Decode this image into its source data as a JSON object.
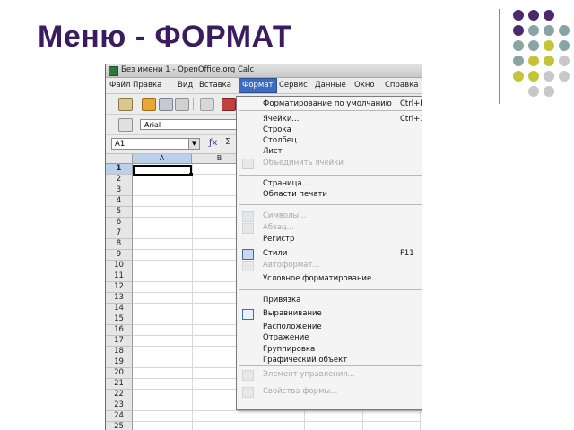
{
  "slide": {
    "title": "Меню - ФОРМАТ",
    "decor_colors": {
      "purple": "#4a2a6a",
      "teal": "#8aa4a4",
      "olive": "#c4c43a",
      "gray": "#c8c8c8"
    }
  },
  "window": {
    "title": "Без имени 1 - OpenOffice.org Calc"
  },
  "menubar": {
    "items": [
      "Файл",
      "Правка",
      "Вид",
      "Вставка",
      "Формат",
      "Сервис",
      "Данные",
      "Окно",
      "Справка"
    ],
    "active": "Формат"
  },
  "toolbar2": {
    "font_name": "Arial"
  },
  "formulabar": {
    "cell_ref": "A1"
  },
  "grid": {
    "columns": [
      "A",
      "B"
    ],
    "rows": [
      "1",
      "2",
      "3",
      "4",
      "5",
      "6",
      "7",
      "8",
      "9",
      "10",
      "11",
      "12",
      "13",
      "14",
      "15",
      "16",
      "17",
      "18",
      "19",
      "20",
      "21",
      "22",
      "23",
      "24",
      "25"
    ],
    "active_cell": "A1"
  },
  "format_menu": {
    "items": [
      {
        "label": "Форматирование по умолчанию",
        "shortcut": "Ctrl+M",
        "disabled": false,
        "icon": ""
      },
      {
        "label": "Ячейки...",
        "shortcut": "Ctrl+1",
        "disabled": false,
        "icon": ""
      },
      {
        "label": "Строка",
        "shortcut": "",
        "disabled": false,
        "icon": ""
      },
      {
        "label": "Столбец",
        "shortcut": "",
        "disabled": false,
        "icon": ""
      },
      {
        "label": "Лист",
        "shortcut": "",
        "disabled": false,
        "icon": ""
      },
      {
        "label": "Объединить ячейки",
        "shortcut": "",
        "disabled": true,
        "icon": "merge-cells-icon"
      },
      {
        "label": "Страница...",
        "shortcut": "",
        "disabled": false,
        "icon": ""
      },
      {
        "label": "Области печати",
        "shortcut": "",
        "disabled": false,
        "icon": ""
      },
      {
        "label": "Символы...",
        "shortcut": "",
        "disabled": true,
        "icon": "characters-icon"
      },
      {
        "label": "Абзац...",
        "shortcut": "",
        "disabled": true,
        "icon": "paragraph-icon"
      },
      {
        "label": "Регистр",
        "shortcut": "",
        "disabled": false,
        "icon": ""
      },
      {
        "label": "Стили",
        "shortcut": "F11",
        "disabled": false,
        "icon": "styles-icon"
      },
      {
        "label": "Автоформат...",
        "shortcut": "",
        "disabled": true,
        "icon": "autoformat-icon"
      },
      {
        "label": "Условное форматирование...",
        "shortcut": "",
        "disabled": false,
        "icon": ""
      },
      {
        "label": "Привязка",
        "shortcut": "",
        "disabled": false,
        "icon": ""
      },
      {
        "label": "Выравнивание",
        "shortcut": "",
        "disabled": false,
        "icon": "alignment-icon"
      },
      {
        "label": "Расположение",
        "shortcut": "",
        "disabled": false,
        "icon": ""
      },
      {
        "label": "Отражение",
        "shortcut": "",
        "disabled": false,
        "icon": ""
      },
      {
        "label": "Группировка",
        "shortcut": "",
        "disabled": false,
        "icon": ""
      },
      {
        "label": "Графический объект",
        "shortcut": "",
        "disabled": false,
        "icon": ""
      },
      {
        "label": "Элемент управления...",
        "shortcut": "",
        "disabled": true,
        "icon": "control-icon"
      },
      {
        "label": "Свойства формы...",
        "shortcut": "",
        "disabled": true,
        "icon": "form-properties-icon"
      }
    ]
  }
}
